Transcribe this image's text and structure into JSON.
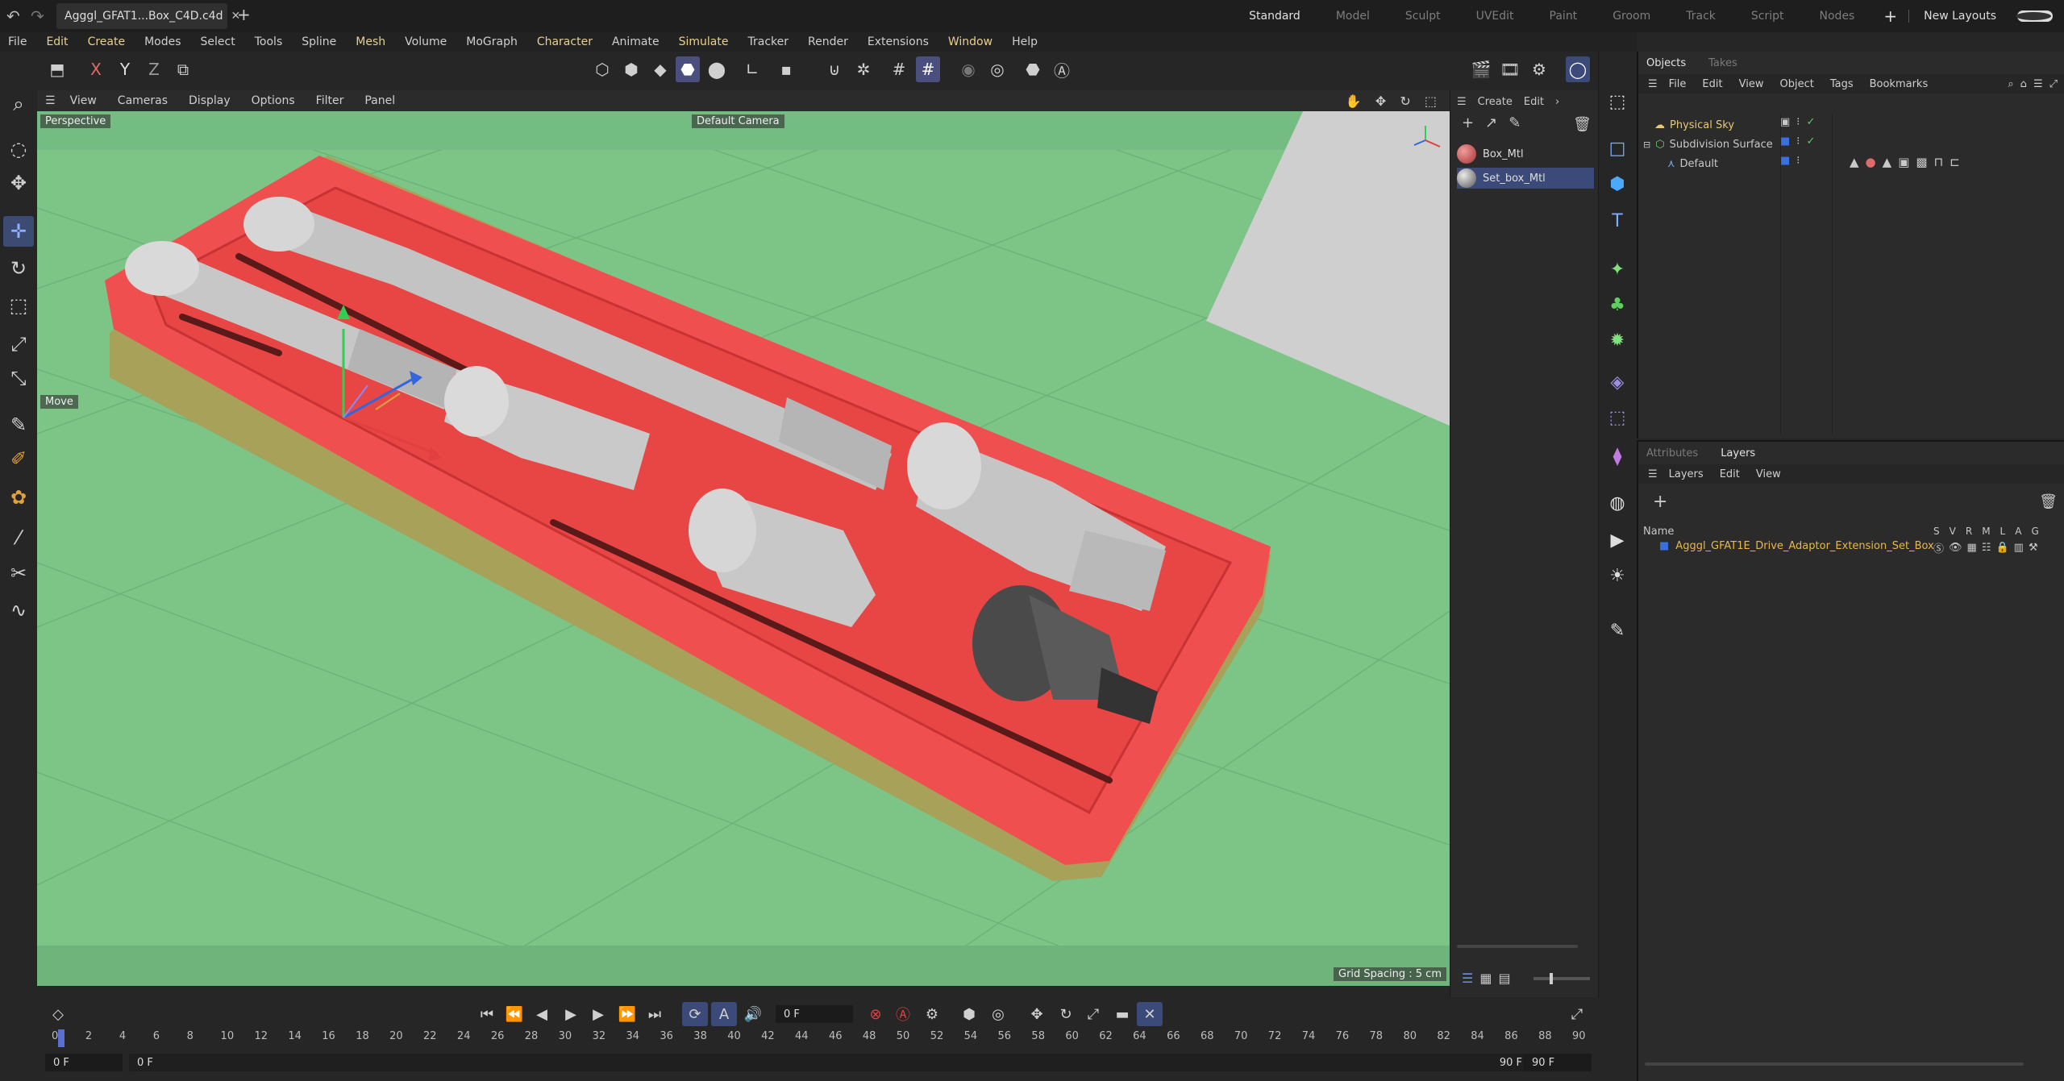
{
  "titlebar": {
    "file_tab": "Agggl_GFAT1...Box_C4D.c4d",
    "layouts": [
      "Standard",
      "Model",
      "Sculpt",
      "UVEdit",
      "Paint",
      "Groom",
      "Track",
      "Script",
      "Nodes"
    ],
    "active_layout": "Standard",
    "new_layouts": "New Layouts"
  },
  "menubar": [
    "File",
    "Edit",
    "Create",
    "Modes",
    "Select",
    "Tools",
    "Spline",
    "Mesh",
    "Volume",
    "MoGraph",
    "Character",
    "Animate",
    "Simulate",
    "Tracker",
    "Render",
    "Extensions",
    "Window",
    "Help"
  ],
  "viewport": {
    "menu": [
      "View",
      "Cameras",
      "Display",
      "Options",
      "Filter",
      "Panel"
    ],
    "label": "Perspective",
    "camera": "Default Camera",
    "tool_hint": "Move",
    "grid_spacing": "Grid Spacing : 5 cm",
    "colors": {
      "ground": "#7dc487",
      "tray": "#ef4f4f",
      "base": "#a8a15a",
      "metal": "#c9c9c9"
    }
  },
  "materials": {
    "menu": [
      "Create",
      "Edit"
    ],
    "items": [
      {
        "name": "Box_Mtl",
        "selected": false
      },
      {
        "name": "Set_box_Mtl",
        "selected": true
      }
    ]
  },
  "objects_panel": {
    "tabs": [
      "Objects",
      "Takes"
    ],
    "menu": [
      "File",
      "Edit",
      "View",
      "Object",
      "Tags",
      "Bookmarks"
    ],
    "items": [
      {
        "name": "Physical Sky",
        "color": "#e8c97a"
      },
      {
        "name": "Subdivision Surface",
        "color": "#cfcfcf"
      },
      {
        "name": "Default",
        "color": "#cfcfcf"
      }
    ]
  },
  "layers_panel": {
    "tabs": [
      "Attributes",
      "Layers"
    ],
    "menu": [
      "Layers",
      "Edit",
      "View"
    ],
    "columns": [
      "S",
      "V",
      "R",
      "M",
      "L",
      "A",
      "G"
    ],
    "name_header": "Name",
    "layer": "Agggl_GFAT1E_Drive_Adaptor_Extension_Set_Box"
  },
  "timeline": {
    "current_frame": "0 F",
    "ticks": [
      "0",
      "2",
      "4",
      "6",
      "8",
      "10",
      "12",
      "14",
      "16",
      "18",
      "20",
      "22",
      "24",
      "26",
      "28",
      "30",
      "32",
      "34",
      "36",
      "38",
      "40",
      "42",
      "44",
      "46",
      "48",
      "50",
      "52",
      "54",
      "56",
      "58",
      "60",
      "62",
      "64",
      "66",
      "68",
      "70",
      "72",
      "74",
      "76",
      "78",
      "80",
      "82",
      "84",
      "86",
      "88",
      "90"
    ],
    "start": "0 F",
    "start2": "0 F",
    "end": "90 F",
    "end2": "90 F"
  }
}
